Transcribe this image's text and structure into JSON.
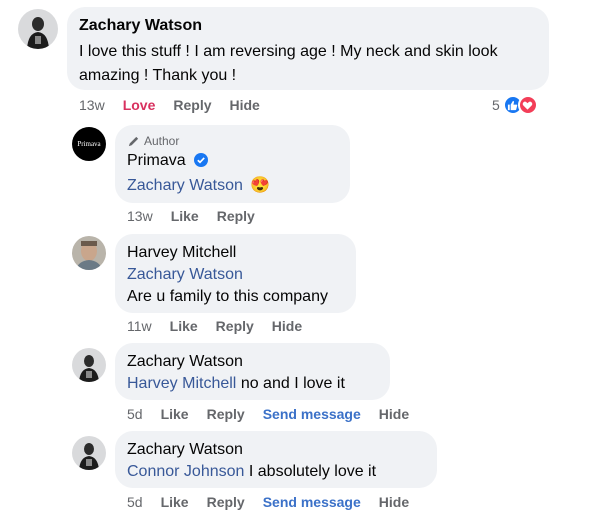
{
  "colors": {
    "bubble": "#f0f2f5",
    "mention": "#385898",
    "love": "#d8315f",
    "meta": "#65676b",
    "send": "#3b71c8",
    "verified": "#1877f2"
  },
  "comments": [
    {
      "author": "Zachary Watson",
      "text": "I love this stuff ! I am reversing age ! My neck and skin look amazing ! Thank you !",
      "time": "13w",
      "love_label": "Love",
      "reply_label": "Reply",
      "hide_label": "Hide",
      "reaction_count": "5",
      "reaction_icons": [
        "like-icon",
        "love-icon"
      ]
    },
    {
      "badge": "Author",
      "author": "Primava",
      "avatar_text": "Primava",
      "mention": "Zachary Watson",
      "emoji": "😍",
      "time": "13w",
      "like_label": "Like",
      "reply_label": "Reply"
    },
    {
      "author": "Harvey Mitchell",
      "mention": "Zachary Watson",
      "text": "Are u family to this company",
      "time": "11w",
      "like_label": "Like",
      "reply_label": "Reply",
      "hide_label": "Hide"
    },
    {
      "author": "Zachary Watson",
      "mention": "Harvey Mitchell",
      "text": "no and I love it",
      "time": "5d",
      "like_label": "Like",
      "reply_label": "Reply",
      "send_label": "Send message",
      "hide_label": "Hide"
    },
    {
      "author": "Zachary Watson",
      "mention": "Connor Johnson",
      "text": "I absolutely love it",
      "time": "5d",
      "like_label": "Like",
      "reply_label": "Reply",
      "send_label": "Send message",
      "hide_label": "Hide"
    }
  ]
}
